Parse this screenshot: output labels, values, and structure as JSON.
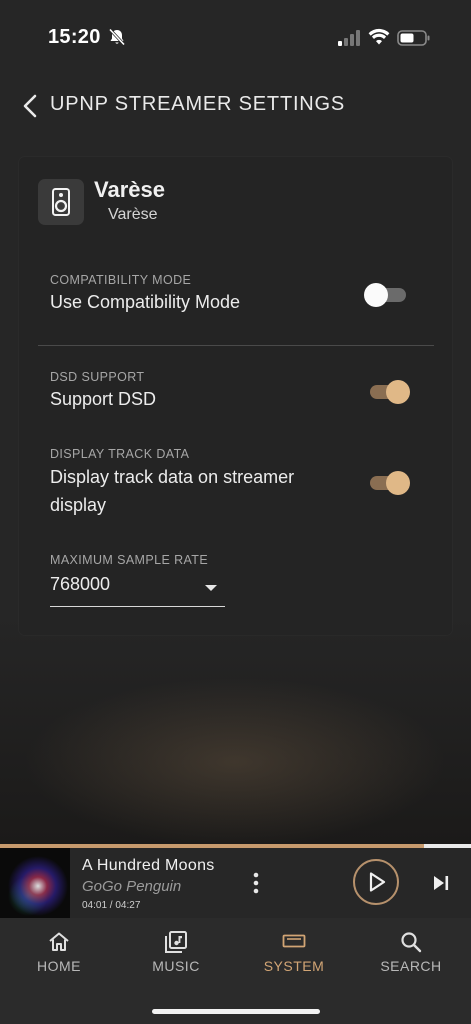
{
  "status_bar": {
    "time": "15:20"
  },
  "header": {
    "title": "UPNP STREAMER SETTINGS"
  },
  "device": {
    "name": "Varèse",
    "subtitle": "Varèse"
  },
  "settings": {
    "compatibility": {
      "caption": "COMPATIBILITY MODE",
      "label": "Use Compatibility Mode",
      "enabled": false
    },
    "dsd": {
      "caption": "DSD SUPPORT",
      "label": "Support DSD",
      "enabled": true
    },
    "track_data": {
      "caption": "DISPLAY TRACK DATA",
      "label_line1": "Display track data on streamer",
      "label_line2": "display",
      "enabled": true
    },
    "sample_rate": {
      "caption": "MAXIMUM SAMPLE RATE",
      "value": "768000"
    }
  },
  "now_playing": {
    "title": "A Hundred Moons",
    "artist": "GoGo Penguin",
    "time": "04:01 / 04:27",
    "progress": 0.9
  },
  "tabs": [
    {
      "label": "HOME",
      "icon": "home-icon",
      "active": false
    },
    {
      "label": "MUSIC",
      "icon": "music-library-icon",
      "active": false
    },
    {
      "label": "SYSTEM",
      "icon": "system-device-icon",
      "active": true
    },
    {
      "label": "SEARCH",
      "icon": "search-icon",
      "active": false
    }
  ],
  "colors": {
    "accent": "#d2a575",
    "toggle_on_knob": "#e0b887",
    "toggle_on_track": "#8a6e52"
  }
}
